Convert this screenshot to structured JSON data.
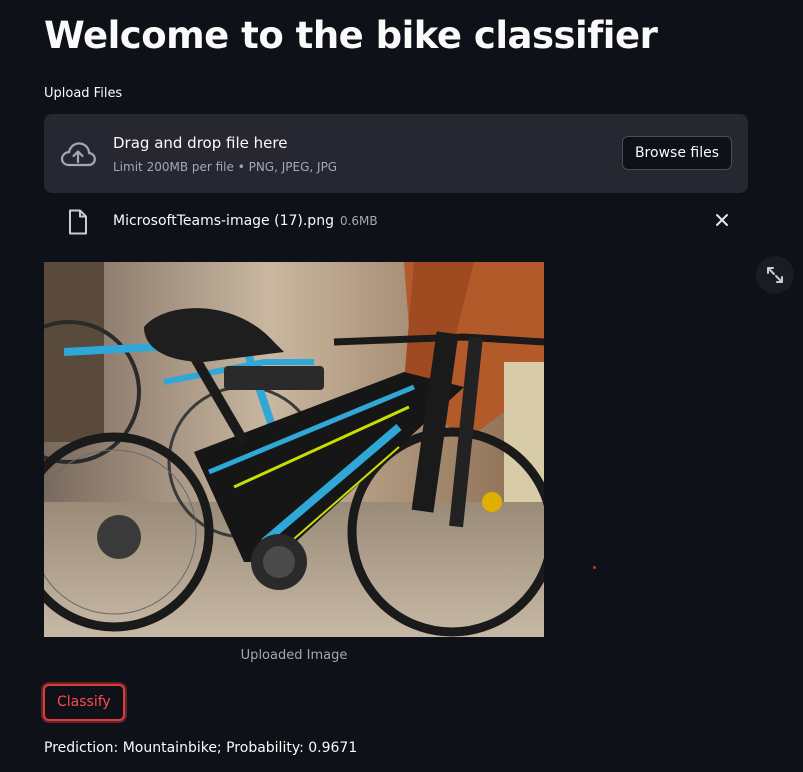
{
  "page": {
    "title": "Welcome to the bike classifier"
  },
  "uploader": {
    "label": "Upload Files",
    "dropzone_title": "Drag and drop file here",
    "dropzone_limit": "Limit 200MB per file • PNG, JPEG, JPG",
    "browse_label": "Browse files",
    "icon": "cloud-upload-icon"
  },
  "file": {
    "name": "MicrosoftTeams-image (17).png",
    "size": "0.6MB",
    "icon": "file-icon",
    "remove_icon": "close-icon"
  },
  "image": {
    "caption": "Uploaded Image"
  },
  "actions": {
    "classify_label": "Classify"
  },
  "result": {
    "text": "Prediction: Mountainbike; Probability: 0.9671"
  },
  "colors": {
    "background": "#0e1117",
    "dropzone": "#262730",
    "accent": "#ff4b4b",
    "muted_text": "#a3a8b8"
  }
}
